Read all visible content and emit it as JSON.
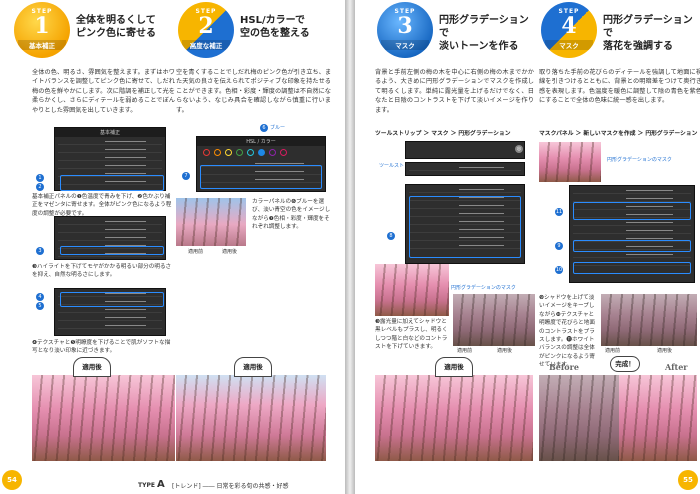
{
  "left_page": {
    "page_number": "54",
    "footer_type_label": "TYPE",
    "footer_type_letter": "A",
    "footer_title": "[トレンド] ―― 日常を彩る旬の共感・好感",
    "step1": {
      "step_label": "STEP",
      "number": "1",
      "badge_label": "基本補正",
      "title": "全体を明るくして\nピンク色に寄せる",
      "body": "全体の色、明るさ、雰囲気を整えます。まずはホワイトバランスを調整してピンク色に寄せて、しだれ梅の色を鮮やかにします。次に階調を補正して光を柔らかくし、さらにディテールを弱めることでぼんやりとした雰囲気を出していきます。",
      "panel_title": "基本補正",
      "note1": "基本補正パネルの❶色温度で青みを下げ、❷色かぶり補正をマゼンタに寄せます。全体がピンク色になるよう程度の調整が必要です。",
      "note2": "❸ハイライトを下げてモヤがかかる明るい部分の明るさを抑え、自然な明るさにします。",
      "note3": "❹テクスチャと❺明瞭度を下げることで肌がソフトな描写となり淡い印象に近づきます。",
      "after_label": "適用後"
    },
    "step2": {
      "step_label": "STEP",
      "number": "2",
      "badge_label": "高度な補正",
      "title": "HSL/カラーで\n空の色を整える",
      "body": "空を青くすることでしだれ梅のピンク色が引き立ち、また天気の良さを伝えられてポジティブな印象を持たせることができます。色相・彩度・輝度の調整は不自然にならないよう、なじみ具合を確認しながら慎重に行います。",
      "panel_title": "HSL / カラー",
      "tag_blue": "ブルー",
      "note1": "カラーパネルの❻ブルーを選び、淡い青空の色をイメージしながら❼色相・彩度・輝度をそれぞれ調整します。",
      "label_before": "適用前",
      "label_after": "適用後",
      "after_label": "適用後"
    }
  },
  "right_page": {
    "page_number": "55",
    "step3": {
      "step_label": "STEP",
      "number": "3",
      "badge_label": "マスク",
      "title": "円形グラデーションで\n淡いトーンを作る",
      "body": "背景と手前左側の梅の木を中心に右側の梅の木までかかるよう、大きめに円形グラデーションでマスクを作成して明るくします。単純に露光量を上げるだけでなく、日なたと日陰のコントラストを下げて淡いイメージを作ります。",
      "toolpath": "ツールストリップ ＞ マスク ＞ 円形グラデーション",
      "tool_label": "ツールストリップ",
      "mask_label": "円形グラデーションのマスク",
      "note1": "❸露光量に加えてシャドウと黒レベルもプラスし、明るくしつつ階と白などのコントラストを下げていきます。",
      "label_before": "適用前",
      "label_after": "適用後",
      "after_label": "適用後"
    },
    "step4": {
      "step_label": "STEP",
      "number": "4",
      "badge_label": "マスク",
      "title": "円形グラデーションで\n落花を強調する",
      "body": "取り落ちた手前の花びらのディテールを強調して地面に視線を引きつけるとともに、背景との明暗差をつけて奥行き感を表現します。色温度を暖色に調整して陰の青色を紫色にすることで全体の色味に統一感を出します。",
      "toolpath": "マスクパネル ＞ 新しいマスクを作成 ＞ 円形グラデーション",
      "mask_label": "円形グラデーションのマスク",
      "note1": "❾シャドウを上げて淡いイメージをキープしながら❿テクスチャと明瞭度で花びらと地面のコントラストをプラスします。⓫ホワイトバランスの調整は全体がピンクになるよう寄せています。",
      "label_before": "適用前",
      "label_after": "適用後",
      "before_label": "Before",
      "done_label": "完成！",
      "after_en": "After"
    }
  }
}
